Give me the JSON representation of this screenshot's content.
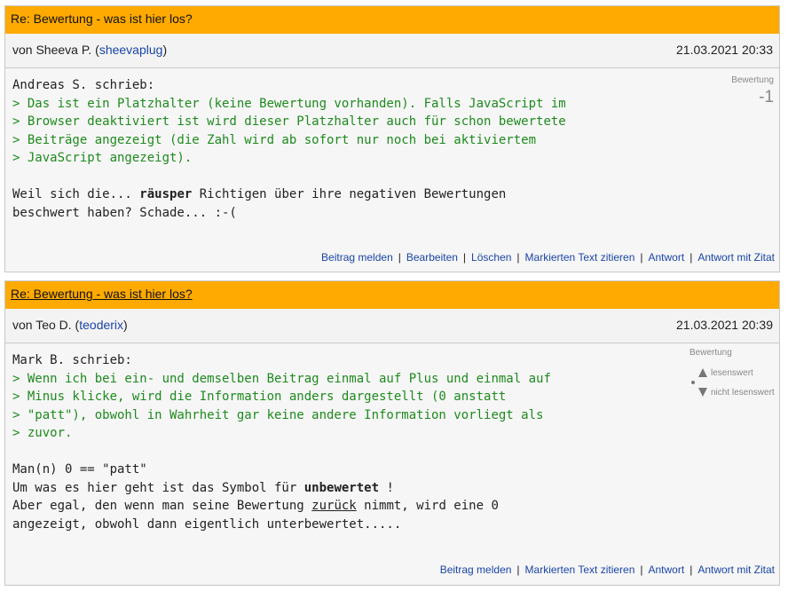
{
  "posts": [
    {
      "title": "Re: Bewertung - was ist hier los?",
      "author_prefix": "von Sheeva P. (",
      "author_user": "sheevaplug",
      "author_suffix": ")",
      "date": "21.03.2021 20:33",
      "rating_label": "Bewertung",
      "rating_value": "-1",
      "lines": [
        {
          "type": "plain",
          "text": "Andreas S. schrieb:"
        },
        {
          "type": "quote",
          "text": "> Das ist ein Platzhalter (keine Bewertung vorhanden). Falls JavaScript im"
        },
        {
          "type": "quote",
          "text": "> Browser deaktiviert ist wird dieser Platzhalter auch für schon bewertete"
        },
        {
          "type": "quote",
          "text": "> Beiträge angezeigt (die Zahl wird ab sofort nur noch bei aktiviertem"
        },
        {
          "type": "quote",
          "text": "> JavaScript angezeigt)."
        },
        {
          "type": "plain",
          "text": ""
        },
        {
          "type": "mixed",
          "parts": [
            {
              "t": "Weil sich die... "
            },
            {
              "t": "räusper",
              "b": true
            },
            {
              "t": " Richtigen über ihre negativen Bewertungen"
            }
          ]
        },
        {
          "type": "plain",
          "text": "beschwert haben? Schade... :-("
        }
      ],
      "actions": [
        "Beitrag melden",
        "Bearbeiten",
        "Löschen",
        "Markierten Text zitieren",
        "Antwort",
        "Antwort mit Zitat"
      ]
    },
    {
      "title": "Re: Bewertung - was ist hier los?",
      "author_prefix": "von Teo D. (",
      "author_user": "teoderix",
      "author_suffix": ")",
      "date": "21.03.2021 20:39",
      "rating_label": "Bewertung",
      "rating_up": "lesenswert",
      "rating_down": "nicht lesenswert",
      "lines": [
        {
          "type": "plain",
          "text": "Mark B. schrieb:"
        },
        {
          "type": "quote",
          "text": "> Wenn ich bei ein- und demselben Beitrag einmal auf Plus und einmal auf"
        },
        {
          "type": "quote",
          "text": "> Minus klicke, wird die Information anders dargestellt (0 anstatt"
        },
        {
          "type": "quote",
          "text": "> \"patt\"), obwohl in Wahrheit gar keine andere Information vorliegt als"
        },
        {
          "type": "quote",
          "text": "> zuvor."
        },
        {
          "type": "plain",
          "text": ""
        },
        {
          "type": "plain",
          "text": "Man(n) 0 == \"patt\""
        },
        {
          "type": "mixed",
          "parts": [
            {
              "t": "Um was es hier geht ist das Symbol für "
            },
            {
              "t": "unbewertet",
              "b": true
            },
            {
              "t": " !"
            }
          ]
        },
        {
          "type": "mixed",
          "parts": [
            {
              "t": "Aber egal, den wenn man seine Bewertung "
            },
            {
              "t": "zurück",
              "u": true
            },
            {
              "t": " nimmt, wird eine 0"
            }
          ]
        },
        {
          "type": "plain",
          "text": "angezeigt, obwohl dann eigentlich unterbewertet....."
        }
      ],
      "actions": [
        "Beitrag melden",
        "Markierten Text zitieren",
        "Antwort",
        "Antwort mit Zitat"
      ]
    }
  ]
}
